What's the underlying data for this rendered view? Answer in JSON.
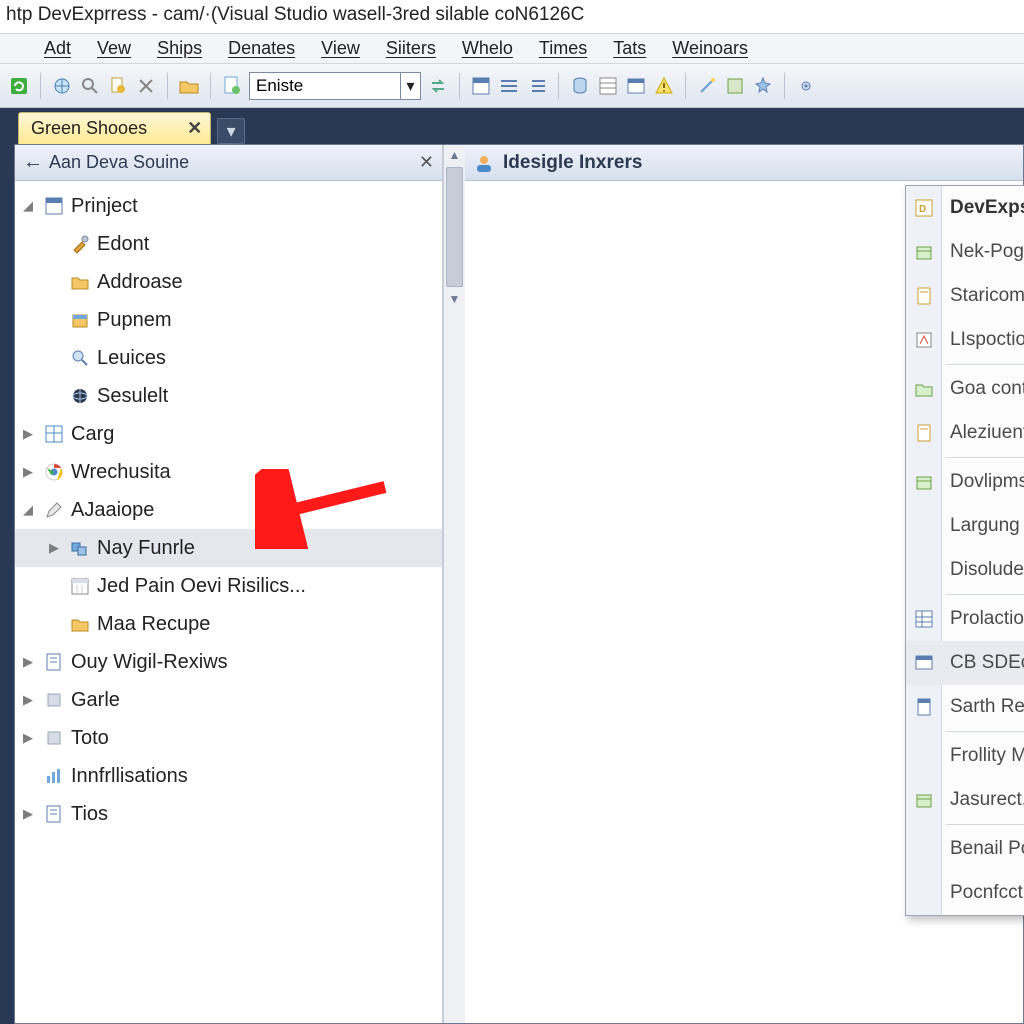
{
  "title": "htp DevExprress - cam/·(Visual Studio wasell-3red  silable coN6126C",
  "menu": [
    "Adt",
    "Vew",
    "Ships",
    "Denates",
    "View",
    "Siiters",
    "Whelo",
    "Times",
    "Tats",
    "Weinoars"
  ],
  "toolbar": {
    "combo_value": "Eniste"
  },
  "tab": {
    "label": "Green Shooes"
  },
  "panel_header": "Aan Deva Souine",
  "fixer_header": "Idesigle Inxrers",
  "tree": [
    {
      "exp": "open",
      "icon": "form",
      "label": "Prinject",
      "depth": 0
    },
    {
      "exp": "",
      "icon": "tool",
      "label": "Edont",
      "depth": 1
    },
    {
      "exp": "",
      "icon": "folder",
      "label": "Addroase",
      "depth": 1
    },
    {
      "exp": "",
      "icon": "box",
      "label": "Pupnem",
      "depth": 1
    },
    {
      "exp": "",
      "icon": "lens",
      "label": "Leuices",
      "depth": 1
    },
    {
      "exp": "",
      "icon": "globe",
      "label": "Sesulelt",
      "depth": 1
    },
    {
      "exp": "closed",
      "icon": "grid",
      "label": "Carg",
      "depth": 0
    },
    {
      "exp": "closed",
      "icon": "chrome",
      "label": "Wrechusita",
      "depth": 0
    },
    {
      "exp": "open",
      "icon": "pen",
      "label": "AJaaiope",
      "depth": 0
    },
    {
      "exp": "closed",
      "icon": "boxes",
      "label": "Nay Funrle",
      "depth": 1,
      "sel": true
    },
    {
      "exp": "",
      "icon": "cal",
      "label": "Jed Pain Oevi Risilics...",
      "depth": 1
    },
    {
      "exp": "",
      "icon": "folder",
      "label": "Maa Recupe",
      "depth": 1
    },
    {
      "exp": "closed",
      "icon": "note",
      "label": "Ouy Wigil-Rexiws",
      "depth": 0
    },
    {
      "exp": "closed",
      "icon": "sq",
      "label": "Garle",
      "depth": 0
    },
    {
      "exp": "closed",
      "icon": "sq",
      "label": "Toto",
      "depth": 0
    },
    {
      "exp": "",
      "icon": "bars",
      "label": "Innfrllisations",
      "depth": 0
    },
    {
      "exp": "closed",
      "icon": "note",
      "label": "Tios",
      "depth": 0
    }
  ],
  "ctx": [
    {
      "icon": "dx",
      "label": "DevExpsress Cheroe",
      "head": true,
      "sub": true
    },
    {
      "icon": "pkg",
      "label": "Nek-Poglency Tchapplie"
    },
    {
      "icon": "page",
      "label": "Staricombuges Temble"
    },
    {
      "icon": "insp",
      "label": "LIspoction"
    },
    {
      "sep": true
    },
    {
      "icon": "fold",
      "label": "Goa contraete",
      "sub": true
    },
    {
      "icon": "page",
      "label": "Aleziuentions"
    },
    {
      "sep": true
    },
    {
      "icon": "pkg",
      "label": "Dovlipmssue R& Prumole...",
      "sub": true
    },
    {
      "label": "Largung Neesiter...",
      "sub": true
    },
    {
      "label": "Disolude raat...",
      "sub": true
    },
    {
      "sep": true
    },
    {
      "icon": "grid2",
      "label": "Prolaction..."
    },
    {
      "icon": "win",
      "label": "CB SDEcium Your Mothrounton...",
      "hover": true
    },
    {
      "icon": "doc",
      "label": "Sarth Requate..."
    },
    {
      "sep": true
    },
    {
      "label": "Frollity Mork..."
    },
    {
      "icon": "pkg",
      "label": "Jasurect..."
    },
    {
      "sep": true
    },
    {
      "label": "Benail Pog..."
    },
    {
      "label": "Pocnfcction"
    }
  ]
}
